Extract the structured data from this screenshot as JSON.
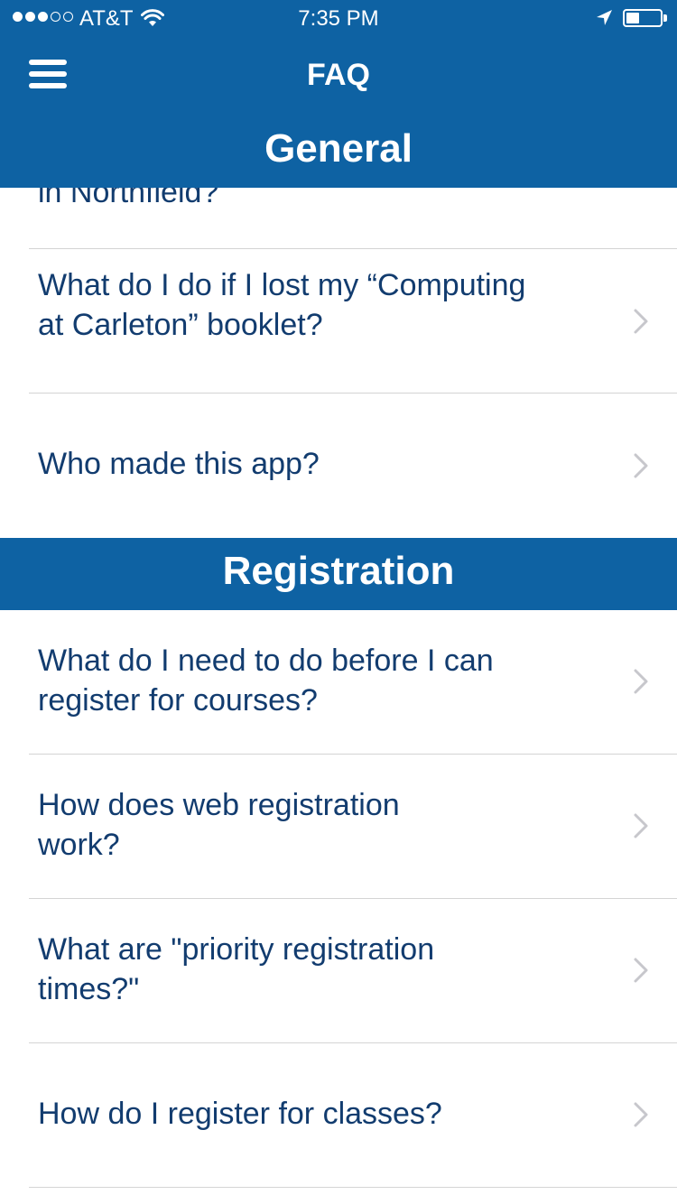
{
  "status_bar": {
    "carrier": "AT&T",
    "time": "7:35 PM",
    "signal_bars_filled": 3,
    "signal_bars_total": 5,
    "battery_level": 0.4,
    "icons": [
      "signal-icon",
      "wifi-icon",
      "location-arrow-icon",
      "battery-icon"
    ]
  },
  "nav": {
    "title": "FAQ",
    "menu_icon": "hamburger-menu-icon"
  },
  "sections": [
    {
      "title": "General",
      "partial_item": "in Northfield?",
      "items": [
        "What do I do if I lost my “Computing at Carleton” booklet?",
        "Who made this app?"
      ]
    },
    {
      "title": "Registration",
      "items": [
        "What do I need to do before I can register for courses?",
        "How does web registration work?",
        "What are \"priority registration times?\"",
        "How do I register for classes?"
      ]
    }
  ],
  "colors": {
    "brand": "#0e62a3",
    "text": "#123c6f",
    "chevron": "#c7c7cc",
    "divider": "#d4d4d4"
  }
}
